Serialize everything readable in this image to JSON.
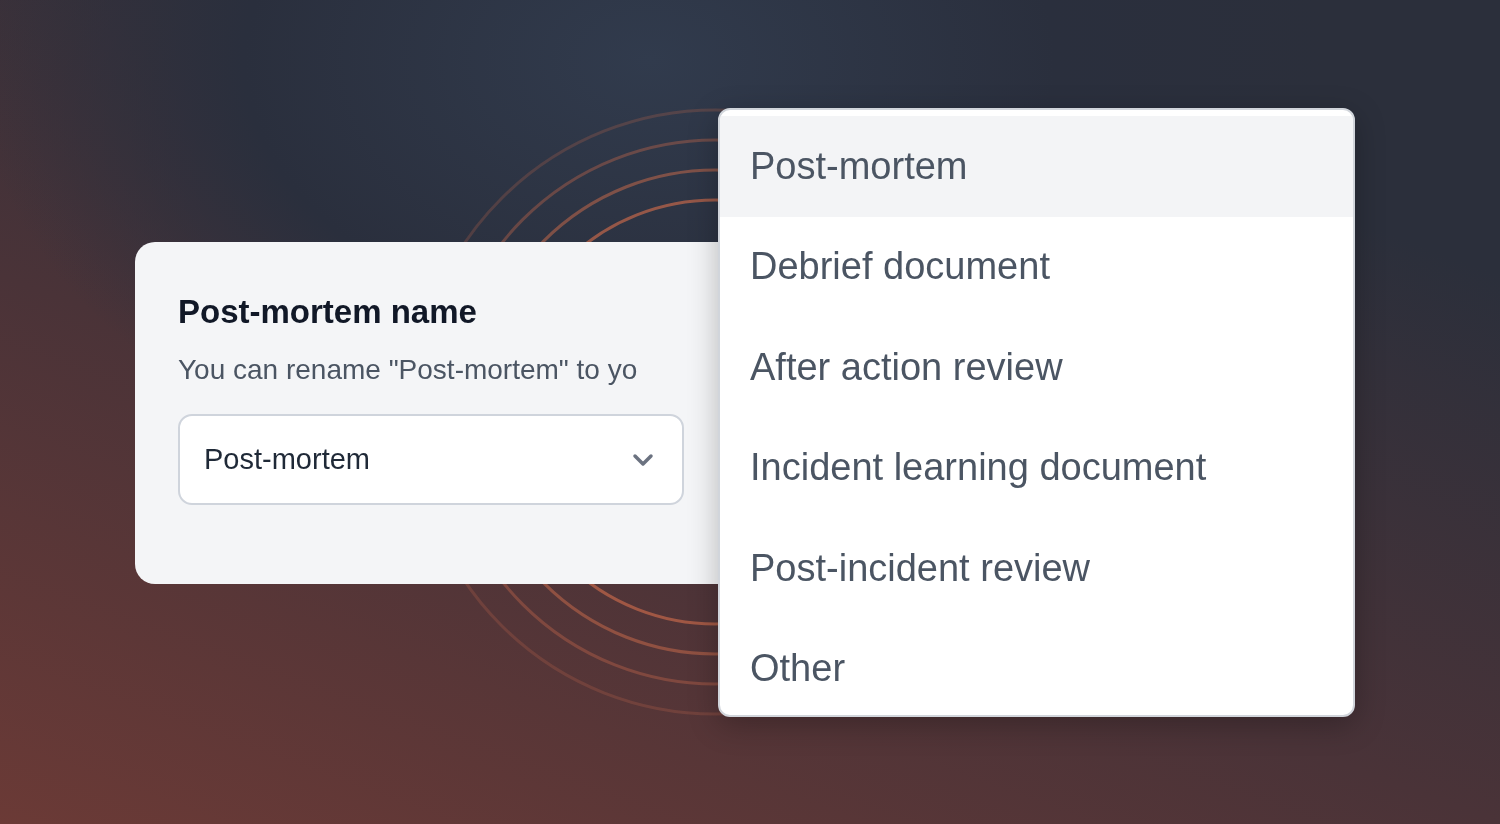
{
  "settings_card": {
    "title": "Post-mortem name",
    "description": "You can rename \"Post-mortem\" to yo",
    "select": {
      "value": "Post-mortem"
    }
  },
  "dropdown": {
    "options": [
      {
        "label": "Post-mortem",
        "selected": true
      },
      {
        "label": "Debrief document",
        "selected": false
      },
      {
        "label": "After action review",
        "selected": false
      },
      {
        "label": "Incident learning document",
        "selected": false
      },
      {
        "label": "Post-incident review",
        "selected": false
      },
      {
        "label": "Other",
        "selected": false
      }
    ]
  }
}
